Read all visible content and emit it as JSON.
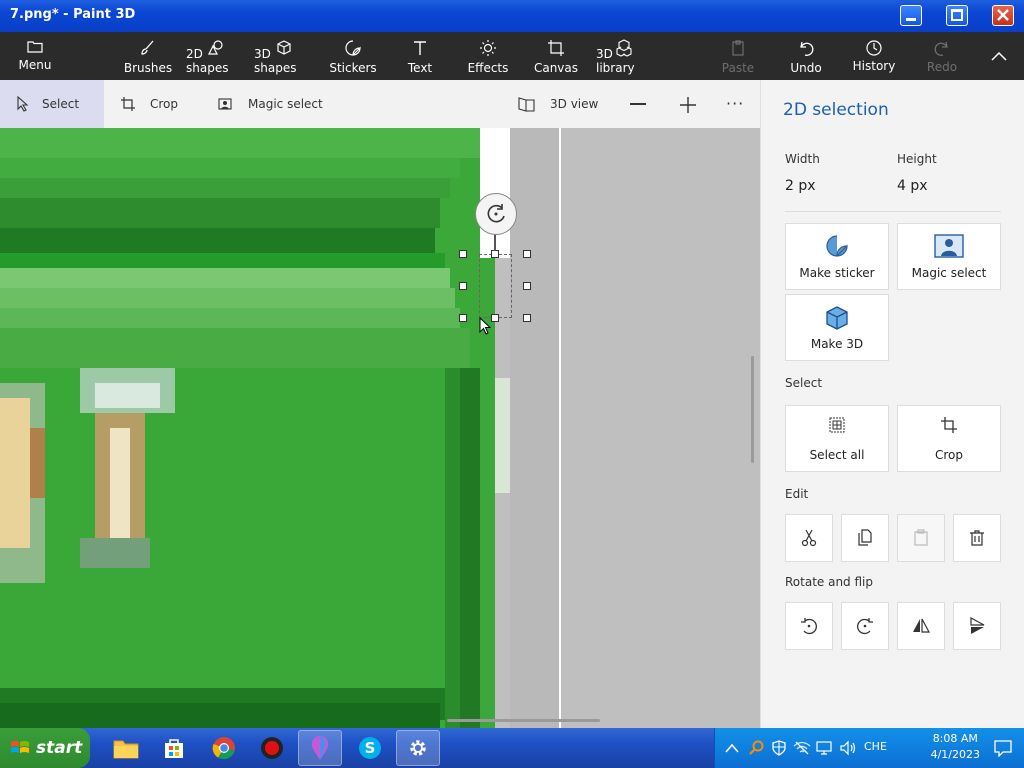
{
  "window": {
    "title": "7.png* - Paint 3D"
  },
  "ribbon": {
    "menu": "Menu",
    "brushes": "Brushes",
    "shapes2d": "2D shapes",
    "shapes3d": "3D shapes",
    "stickers": "Stickers",
    "text": "Text",
    "effects": "Effects",
    "canvas": "Canvas",
    "library3d": "3D library",
    "paste": "Paste",
    "undo": "Undo",
    "history": "History",
    "redo": "Redo"
  },
  "toolbar": {
    "select": "Select",
    "crop": "Crop",
    "magic_select": "Magic select",
    "view3d": "3D view"
  },
  "panel": {
    "title": "2D selection",
    "width_label": "Width",
    "width_value": "2 px",
    "height_label": "Height",
    "height_value": "4 px",
    "make_sticker": "Make sticker",
    "magic_select": "Magic select",
    "make_3d": "Make 3D",
    "select_section": "Select",
    "select_all": "Select all",
    "crop": "Crop",
    "edit_section": "Edit",
    "rotate_section": "Rotate and flip"
  },
  "taskbar": {
    "start": "start",
    "lang": "CHE",
    "time": "8:08 AM",
    "date": "4/1/2023"
  },
  "colors": {
    "accent": "#1a5fb4",
    "canvas_green": "#3da83a",
    "ribbon_bg": "#2b2b2b"
  }
}
